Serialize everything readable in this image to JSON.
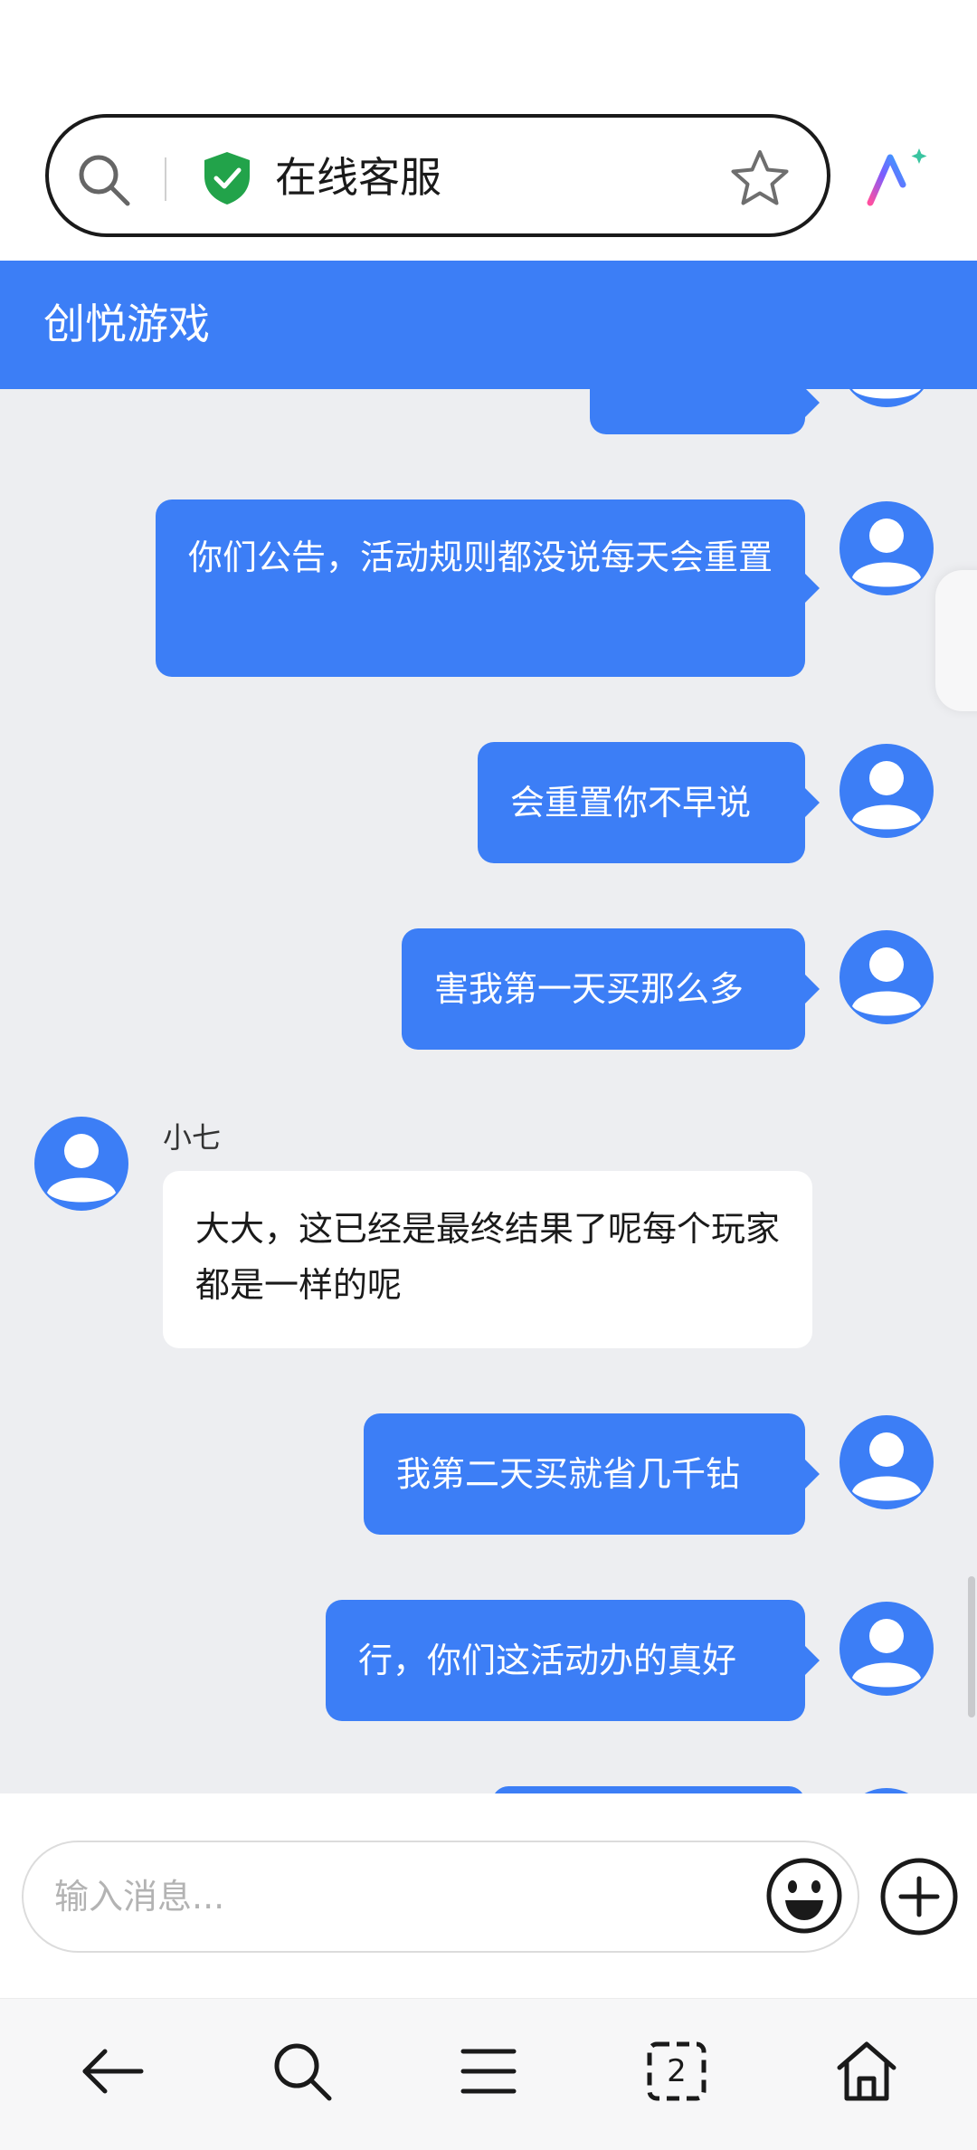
{
  "browser": {
    "address_title": "在线客服",
    "tab_count": "2"
  },
  "site": {
    "title": "创悦游戏"
  },
  "chat": {
    "agent_name": "小七",
    "messages": [
      {
        "from": "user",
        "text": "你们公告，活动规则都没说每天会重置"
      },
      {
        "from": "user",
        "text": "会重置你不早说"
      },
      {
        "from": "user",
        "text": "害我第一天买那么多"
      },
      {
        "from": "agent",
        "text": "大大，这已经是最终结果了呢每个玩家都是一样的呢"
      },
      {
        "from": "user",
        "text": "我第二天买就省几千钻"
      },
      {
        "from": "user",
        "text": "行，你们这活动办的真好"
      }
    ]
  },
  "input": {
    "placeholder": "输入消息...",
    "value": ""
  },
  "colors": {
    "accent": "#3c7ef6",
    "chat_background": "#edeef1",
    "shield": "#22a34a"
  },
  "icons": {
    "address_search": "search-icon",
    "secure": "shield-check-icon",
    "bookmark": "star-icon",
    "assistant": "ai-assistant-icon",
    "emoji": "emoji-icon",
    "more": "plus-icon",
    "nav": [
      "back-arrow-icon",
      "search-icon",
      "menu-icon",
      "tabs-icon",
      "home-icon"
    ]
  }
}
